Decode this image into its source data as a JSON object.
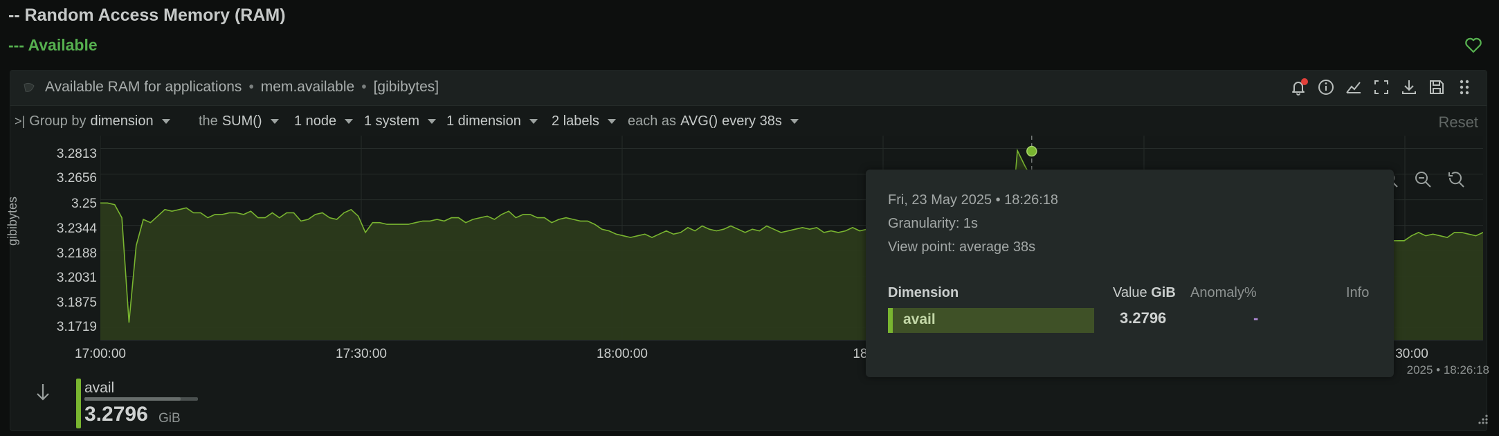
{
  "section": {
    "title": "-- Random Access Memory (RAM)",
    "subsection": "--- Available"
  },
  "chart": {
    "title": "Available RAM for applications",
    "context": "mem.available",
    "units": "[gibibytes]",
    "sep": "•"
  },
  "toolbar": {
    "icons": [
      "alert-bell-icon",
      "info-icon",
      "chart-type-icon",
      "fullscreen-icon",
      "download-icon",
      "save-icon",
      "drag-grip-icon"
    ],
    "alert_dot_color": "#e2403a"
  },
  "group_bar": {
    "group_by_label": "Group by",
    "group_by_value": "dimension",
    "agg_prefix": "the",
    "agg_value": "SUM()",
    "nodes": "1 node",
    "systems": "1 system",
    "dimensions": "1 dimension",
    "labels": "2 labels",
    "time_prefix": "each as",
    "time_agg": "AVG()",
    "time_suffix": "every 38s",
    "reset": "Reset"
  },
  "chart_data": {
    "type": "area",
    "ylabel": "gibibytes",
    "yticks": [
      "3.2813",
      "3.2656",
      "3.25",
      "3.2344",
      "3.2188",
      "3.2031",
      "3.1875",
      "3.1719"
    ],
    "ylim": [
      3.1641,
      3.2891
    ],
    "xticks": [
      "17:00:00",
      "17:30:00",
      "18:00:00",
      "18",
      "30:00"
    ],
    "series": [
      {
        "name": "avail",
        "color": "#79b530",
        "values": [
          3.248,
          3.248,
          3.247,
          3.239,
          3.175,
          3.222,
          3.238,
          3.236,
          3.24,
          3.244,
          3.243,
          3.244,
          3.245,
          3.242,
          3.242,
          3.239,
          3.241,
          3.241,
          3.242,
          3.242,
          3.241,
          3.243,
          3.239,
          3.239,
          3.242,
          3.239,
          3.242,
          3.242,
          3.237,
          3.238,
          3.241,
          3.242,
          3.239,
          3.238,
          3.242,
          3.244,
          3.24,
          3.23,
          3.236,
          3.236,
          3.235,
          3.235,
          3.235,
          3.235,
          3.236,
          3.237,
          3.237,
          3.238,
          3.237,
          3.239,
          3.239,
          3.236,
          3.238,
          3.239,
          3.24,
          3.238,
          3.241,
          3.243,
          3.239,
          3.241,
          3.241,
          3.239,
          3.239,
          3.236,
          3.238,
          3.239,
          3.238,
          3.237,
          3.237,
          3.235,
          3.232,
          3.231,
          3.229,
          3.228,
          3.227,
          3.228,
          3.229,
          3.227,
          3.229,
          3.231,
          3.229,
          3.23,
          3.233,
          3.231,
          3.234,
          3.232,
          3.231,
          3.232,
          3.234,
          3.232,
          3.23,
          3.232,
          3.231,
          3.234,
          3.232,
          3.23,
          3.231,
          3.232,
          3.233,
          3.232,
          3.233,
          3.23,
          3.231,
          3.23,
          3.231,
          3.233,
          3.231,
          3.232,
          3.23,
          3.229,
          3.228,
          3.227,
          3.23,
          3.229,
          3.231,
          3.233,
          3.231,
          3.229,
          3.228,
          3.226,
          3.228,
          3.229,
          3.227,
          3.229,
          3.23,
          3.228,
          3.227,
          3.228,
          3.28,
          3.271,
          3.263,
          3.262,
          3.262,
          3.262,
          3.262,
          3.262,
          3.262,
          3.262,
          3.262,
          3.262,
          3.262,
          3.262,
          3.262,
          3.262,
          3.262,
          3.262,
          3.262,
          3.262,
          3.262,
          3.262,
          3.262,
          3.262,
          3.262,
          3.262,
          3.262,
          3.262,
          3.262,
          3.262,
          3.262,
          3.262,
          3.262,
          3.262,
          3.262,
          3.262,
          3.262,
          3.262,
          3.262,
          3.262,
          3.262,
          3.262,
          3.262,
          3.262,
          3.262,
          3.262,
          3.262,
          3.23,
          3.229,
          3.228,
          3.227,
          3.226,
          3.225,
          3.225,
          3.225,
          3.228,
          3.23,
          3.228,
          3.229,
          3.228,
          3.227,
          3.23,
          3.23,
          3.229,
          3.228,
          3.23
        ]
      }
    ],
    "highlight": {
      "index": 130,
      "value": 3.2796
    }
  },
  "tooltip": {
    "date": "Fri, 23 May 2025 • 18:26:18",
    "granularity": "Granularity: 1s",
    "view_point": "View point: average 38s",
    "col_dimension": "Dimension",
    "col_value": "Value",
    "col_value_unit": "GiB",
    "col_anomaly": "Anomaly%",
    "col_info": "Info",
    "row_name": "avail",
    "row_value": "3.2796",
    "row_anomaly": "-"
  },
  "footer": {
    "stamp": "2025 • 18:26:18"
  },
  "legend": {
    "name": "avail",
    "value": "3.2796",
    "unit": "GiB",
    "fraction": 0.85
  }
}
